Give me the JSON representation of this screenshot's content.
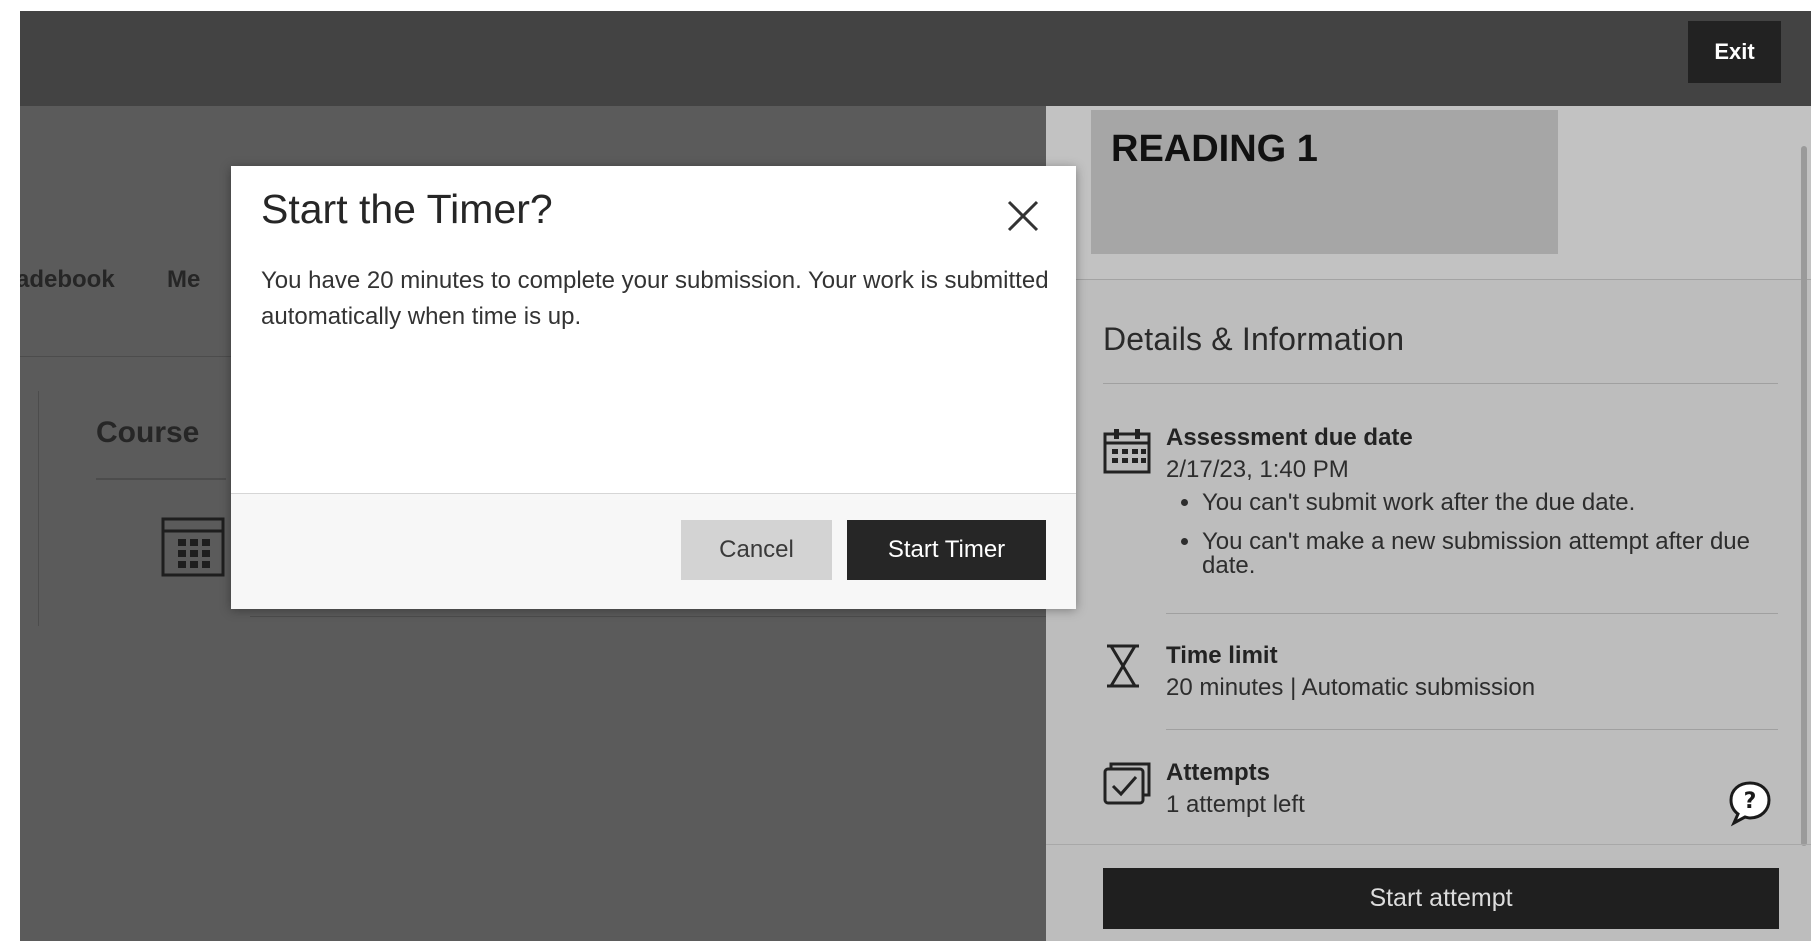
{
  "topbar": {
    "exit_label": "Exit"
  },
  "background": {
    "tabs": [
      "adebook",
      "Me"
    ],
    "heading": "Course"
  },
  "panel": {
    "title": "READING 1",
    "section_title": "Details & Information",
    "due": {
      "label": "Assessment due date",
      "value": "2/17/23, 1:40 PM",
      "notes": [
        "You can't submit work after the due date.",
        "You can't make a new submission attempt after due date."
      ]
    },
    "time_limit": {
      "label": "Time limit",
      "value": "20 minutes | Automatic submission"
    },
    "attempts": {
      "label": "Attempts",
      "value": "1 attempt left"
    },
    "start_label": "Start attempt"
  },
  "modal": {
    "title": "Start the Timer?",
    "body": "You have 20 minutes to complete your submission. Your work is submitted automatically when time is up.",
    "cancel_label": "Cancel",
    "start_label": "Start Timer"
  },
  "icons": {
    "close": "close-icon",
    "calendar": "calendar-icon",
    "hourglass": "hourglass-icon",
    "attempts": "checkbox-icon",
    "help": "help-icon"
  },
  "colors": {
    "topbar": "#434343",
    "dark_button": "#262626",
    "accent_red": "#8b1d1d",
    "panel": "#bdbdbd"
  }
}
